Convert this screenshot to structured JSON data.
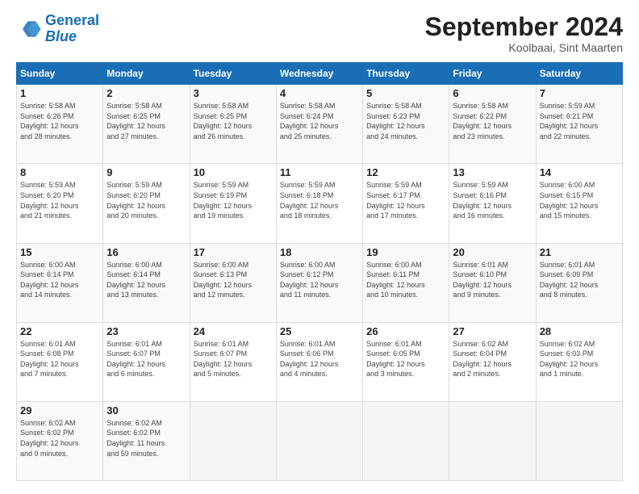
{
  "header": {
    "logo_line1": "General",
    "logo_line2": "Blue",
    "month_title": "September 2024",
    "location": "Koolbaai, Sint Maarten"
  },
  "calendar": {
    "days_of_week": [
      "Sunday",
      "Monday",
      "Tuesday",
      "Wednesday",
      "Thursday",
      "Friday",
      "Saturday"
    ],
    "weeks": [
      [
        {
          "day": "1",
          "info": "Sunrise: 5:58 AM\nSunset: 6:26 PM\nDaylight: 12 hours\nand 28 minutes."
        },
        {
          "day": "2",
          "info": "Sunrise: 5:58 AM\nSunset: 6:25 PM\nDaylight: 12 hours\nand 27 minutes."
        },
        {
          "day": "3",
          "info": "Sunrise: 5:58 AM\nSunset: 6:25 PM\nDaylight: 12 hours\nand 26 minutes."
        },
        {
          "day": "4",
          "info": "Sunrise: 5:58 AM\nSunset: 6:24 PM\nDaylight: 12 hours\nand 25 minutes."
        },
        {
          "day": "5",
          "info": "Sunrise: 5:58 AM\nSunset: 6:23 PM\nDaylight: 12 hours\nand 24 minutes."
        },
        {
          "day": "6",
          "info": "Sunrise: 5:58 AM\nSunset: 6:22 PM\nDaylight: 12 hours\nand 23 minutes."
        },
        {
          "day": "7",
          "info": "Sunrise: 5:59 AM\nSunset: 6:21 PM\nDaylight: 12 hours\nand 22 minutes."
        }
      ],
      [
        {
          "day": "8",
          "info": "Sunrise: 5:59 AM\nSunset: 6:20 PM\nDaylight: 12 hours\nand 21 minutes."
        },
        {
          "day": "9",
          "info": "Sunrise: 5:59 AM\nSunset: 6:20 PM\nDaylight: 12 hours\nand 20 minutes."
        },
        {
          "day": "10",
          "info": "Sunrise: 5:59 AM\nSunset: 6:19 PM\nDaylight: 12 hours\nand 19 minutes."
        },
        {
          "day": "11",
          "info": "Sunrise: 5:59 AM\nSunset: 6:18 PM\nDaylight: 12 hours\nand 18 minutes."
        },
        {
          "day": "12",
          "info": "Sunrise: 5:59 AM\nSunset: 6:17 PM\nDaylight: 12 hours\nand 17 minutes."
        },
        {
          "day": "13",
          "info": "Sunrise: 5:59 AM\nSunset: 6:16 PM\nDaylight: 12 hours\nand 16 minutes."
        },
        {
          "day": "14",
          "info": "Sunrise: 6:00 AM\nSunset: 6:15 PM\nDaylight: 12 hours\nand 15 minutes."
        }
      ],
      [
        {
          "day": "15",
          "info": "Sunrise: 6:00 AM\nSunset: 6:14 PM\nDaylight: 12 hours\nand 14 minutes."
        },
        {
          "day": "16",
          "info": "Sunrise: 6:00 AM\nSunset: 6:14 PM\nDaylight: 12 hours\nand 13 minutes."
        },
        {
          "day": "17",
          "info": "Sunrise: 6:00 AM\nSunset: 6:13 PM\nDaylight: 12 hours\nand 12 minutes."
        },
        {
          "day": "18",
          "info": "Sunrise: 6:00 AM\nSunset: 6:12 PM\nDaylight: 12 hours\nand 11 minutes."
        },
        {
          "day": "19",
          "info": "Sunrise: 6:00 AM\nSunset: 6:11 PM\nDaylight: 12 hours\nand 10 minutes."
        },
        {
          "day": "20",
          "info": "Sunrise: 6:01 AM\nSunset: 6:10 PM\nDaylight: 12 hours\nand 9 minutes."
        },
        {
          "day": "21",
          "info": "Sunrise: 6:01 AM\nSunset: 6:09 PM\nDaylight: 12 hours\nand 8 minutes."
        }
      ],
      [
        {
          "day": "22",
          "info": "Sunrise: 6:01 AM\nSunset: 6:08 PM\nDaylight: 12 hours\nand 7 minutes."
        },
        {
          "day": "23",
          "info": "Sunrise: 6:01 AM\nSunset: 6:07 PM\nDaylight: 12 hours\nand 6 minutes."
        },
        {
          "day": "24",
          "info": "Sunrise: 6:01 AM\nSunset: 6:07 PM\nDaylight: 12 hours\nand 5 minutes."
        },
        {
          "day": "25",
          "info": "Sunrise: 6:01 AM\nSunset: 6:06 PM\nDaylight: 12 hours\nand 4 minutes."
        },
        {
          "day": "26",
          "info": "Sunrise: 6:01 AM\nSunset: 6:05 PM\nDaylight: 12 hours\nand 3 minutes."
        },
        {
          "day": "27",
          "info": "Sunrise: 6:02 AM\nSunset: 6:04 PM\nDaylight: 12 hours\nand 2 minutes."
        },
        {
          "day": "28",
          "info": "Sunrise: 6:02 AM\nSunset: 6:03 PM\nDaylight: 12 hours\nand 1 minute."
        }
      ],
      [
        {
          "day": "29",
          "info": "Sunrise: 6:02 AM\nSunset: 6:02 PM\nDaylight: 12 hours\nand 0 minutes."
        },
        {
          "day": "30",
          "info": "Sunrise: 6:02 AM\nSunset: 6:02 PM\nDaylight: 11 hours\nand 59 minutes."
        },
        {
          "day": "",
          "info": ""
        },
        {
          "day": "",
          "info": ""
        },
        {
          "day": "",
          "info": ""
        },
        {
          "day": "",
          "info": ""
        },
        {
          "day": "",
          "info": ""
        }
      ]
    ]
  }
}
